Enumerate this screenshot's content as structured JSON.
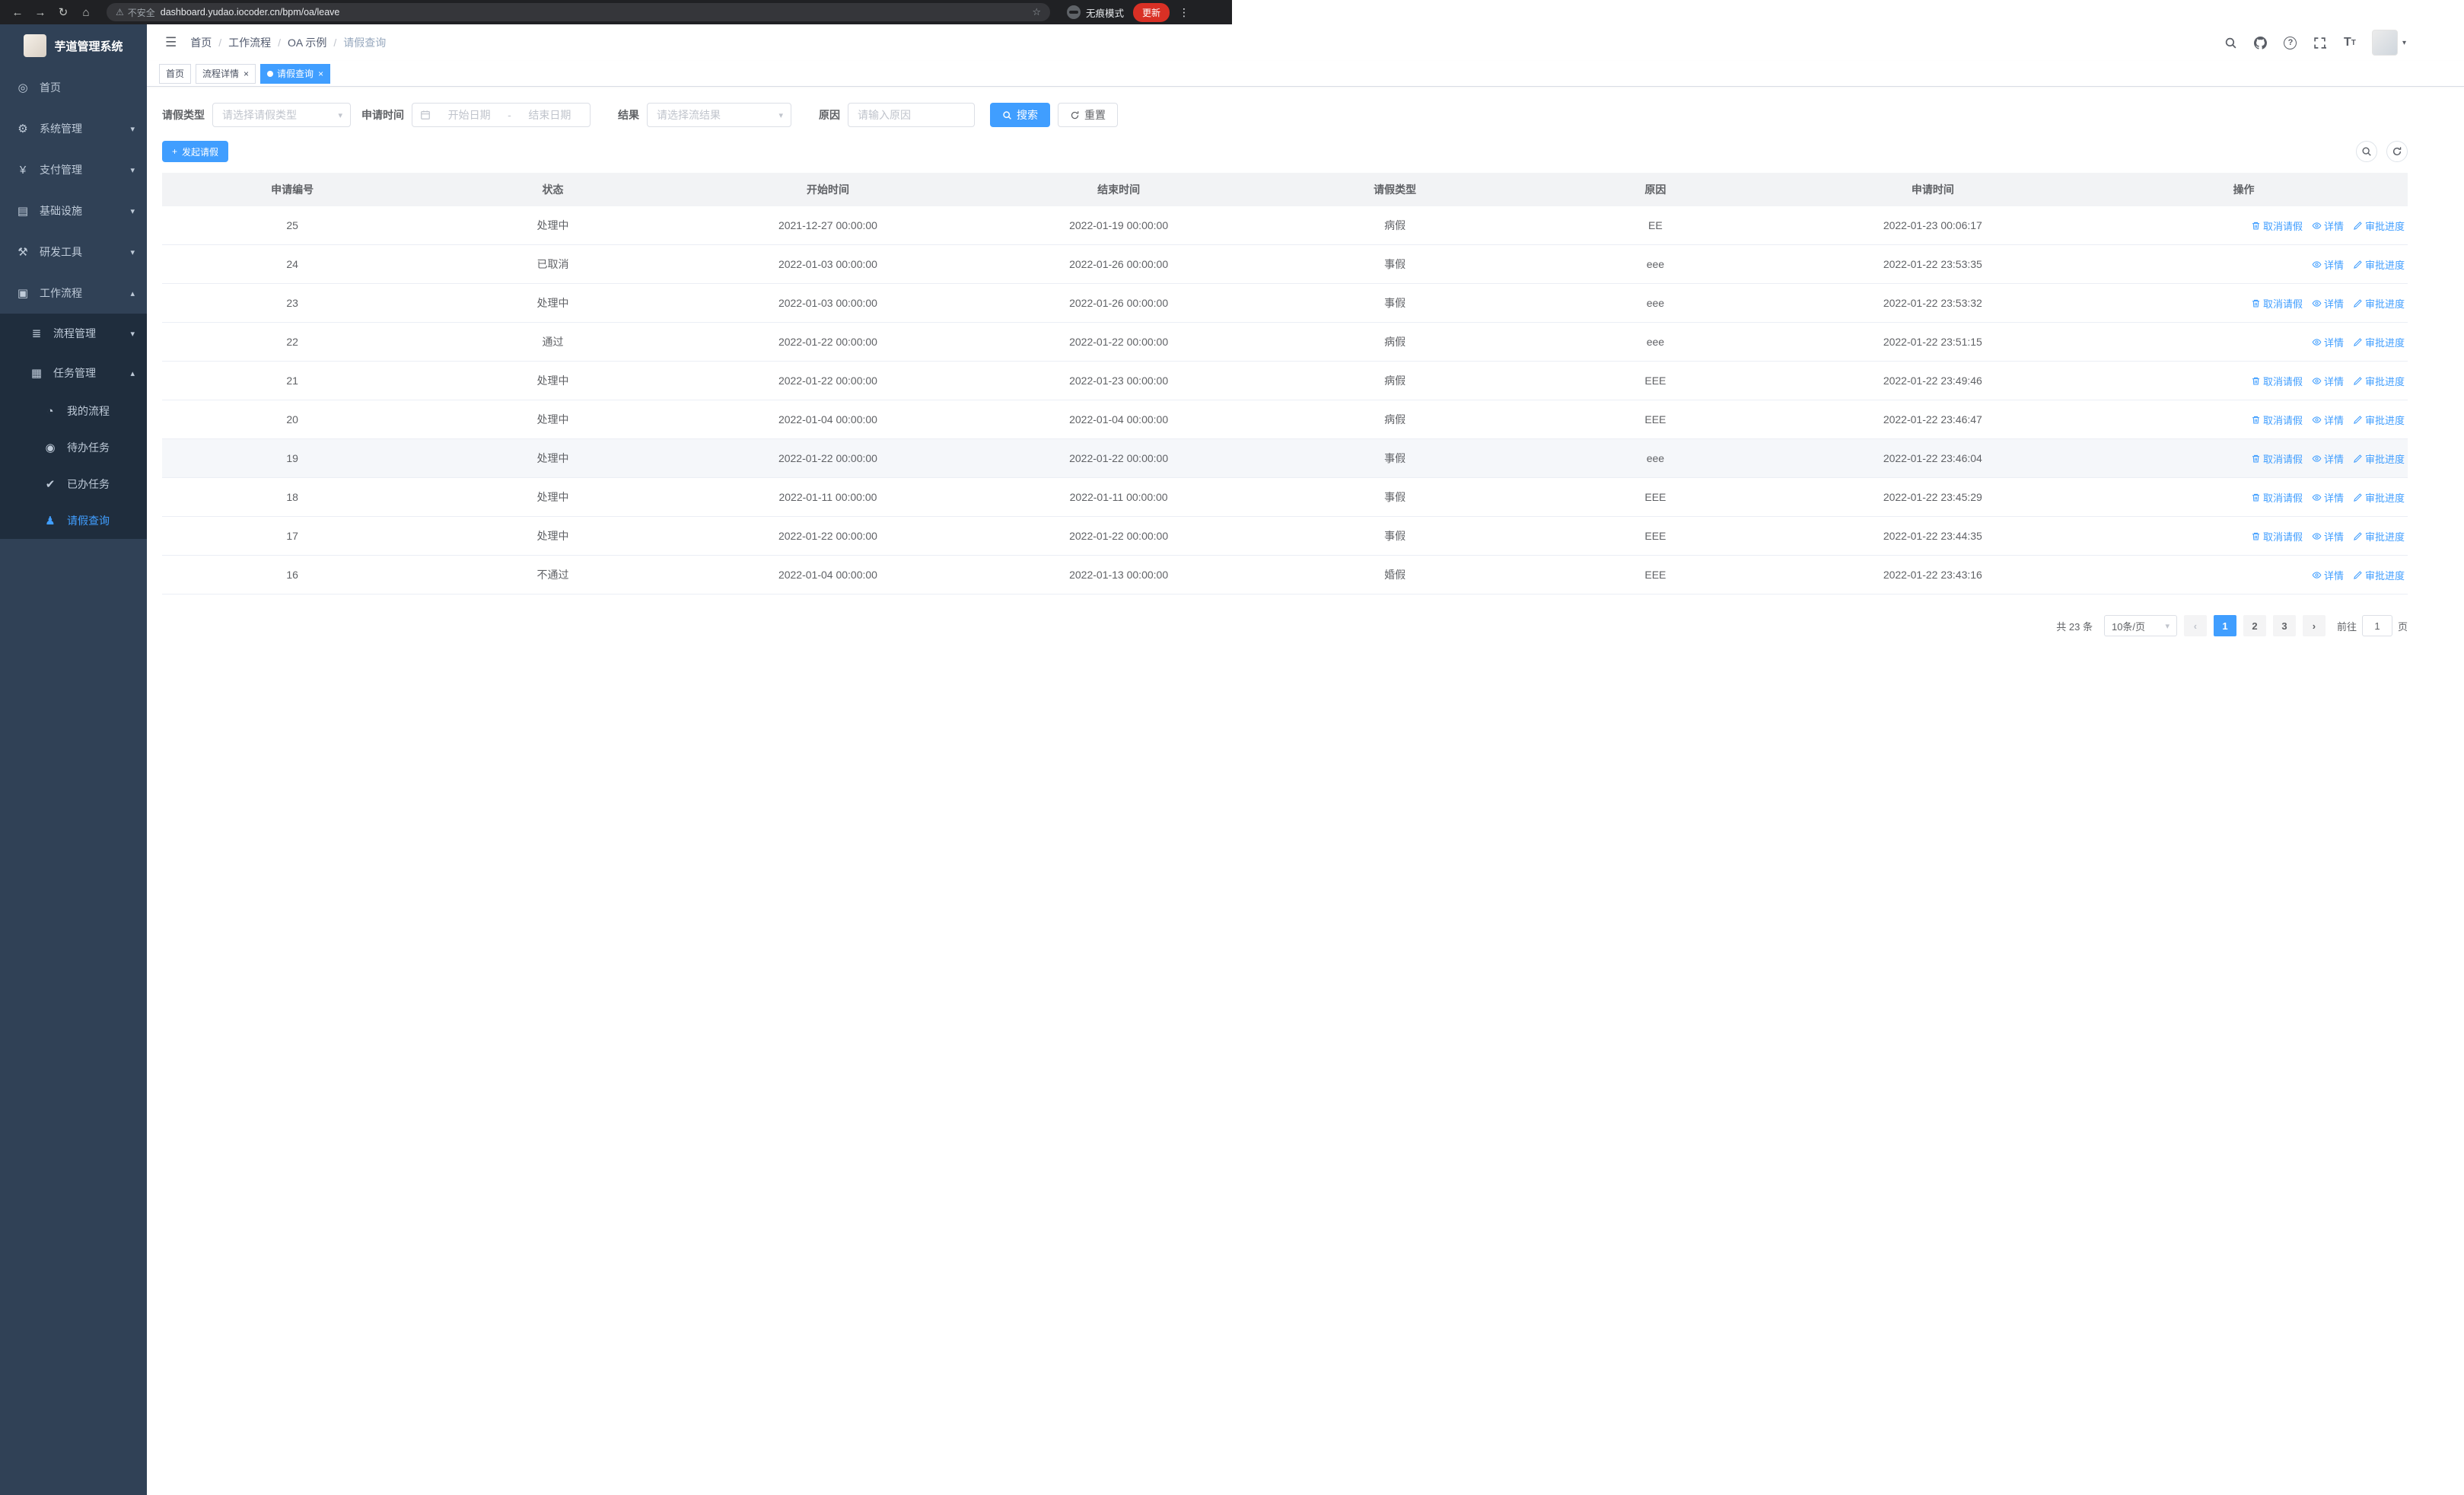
{
  "colors": {
    "primary": "#409eff",
    "sidebar_bg": "#304156",
    "submenu_bg": "#1f2d3d",
    "chrome_bg": "#202124"
  },
  "icons": {
    "back": "←",
    "forward": "→",
    "reload": "↻",
    "home": "⌂",
    "warning": "⚠",
    "star": "☆",
    "dots": "⋮",
    "hamburger": "☰",
    "close": "×",
    "caret": "▾",
    "question": "?",
    "font_size": "T",
    "plus": "+",
    "range_sep": "-",
    "dashboard": "◎",
    "gear": "⚙",
    "yen": "¥",
    "infra": "▤",
    "tools": "⚒",
    "workflow": "▣",
    "process": "≣",
    "task": "▦",
    "chat": "◔",
    "eye": "◉",
    "check": "✔",
    "user": "♟"
  },
  "browser": {
    "security_warning": "不安全",
    "url": "dashboard.yudao.iocoder.cn/bpm/oa/leave",
    "incognito_label": "无痕模式",
    "update_button": "更新"
  },
  "sidebar": {
    "title": "芋道管理系统",
    "items": [
      {
        "label": "首页",
        "chev": ""
      },
      {
        "label": "系统管理",
        "chev": "▾"
      },
      {
        "label": "支付管理",
        "chev": "▾"
      },
      {
        "label": "基础设施",
        "chev": "▾"
      },
      {
        "label": "研发工具",
        "chev": "▾"
      },
      {
        "label": "工作流程",
        "chev": "▴"
      }
    ],
    "submenu": [
      {
        "label": "流程管理",
        "chev": "▾"
      },
      {
        "label": "任务管理",
        "chev": "▴"
      }
    ],
    "task_items": [
      {
        "label": "我的流程"
      },
      {
        "label": "待办任务"
      },
      {
        "label": "已办任务"
      },
      {
        "label": "请假查询"
      }
    ]
  },
  "header": {
    "breadcrumb": [
      "首页",
      "工作流程",
      "OA 示例",
      "请假查询"
    ]
  },
  "tabs": [
    {
      "label": "首页"
    },
    {
      "label": "流程详情"
    },
    {
      "label": "请假查询"
    }
  ],
  "filters": {
    "leave_type_label": "请假类型",
    "leave_type_placeholder": "请选择请假类型",
    "apply_time_label": "申请时间",
    "start_date_placeholder": "开始日期",
    "end_date_placeholder": "结束日期",
    "result_label": "结果",
    "result_placeholder": "请选择流结果",
    "reason_label": "原因",
    "reason_placeholder": "请输入原因",
    "search_button": "搜索",
    "reset_button": "重置"
  },
  "toolbar": {
    "create_button": "发起请假"
  },
  "table": {
    "headers": [
      "申请编号",
      "状态",
      "开始时间",
      "结束时间",
      "请假类型",
      "原因",
      "申请时间",
      "操作"
    ],
    "action_labels": {
      "cancel": "取消请假",
      "detail": "详情",
      "progress": "审批进度"
    },
    "rows": [
      {
        "id": "25",
        "status": "处理中",
        "start": "2021-12-27 00:00:00",
        "end": "2022-01-19 00:00:00",
        "type": "病假",
        "reason": "EE",
        "apply_time": "2022-01-23 00:06:17",
        "actions": [
          "cancel",
          "detail",
          "progress"
        ]
      },
      {
        "id": "24",
        "status": "已取消",
        "start": "2022-01-03 00:00:00",
        "end": "2022-01-26 00:00:00",
        "type": "事假",
        "reason": "eee",
        "apply_time": "2022-01-22 23:53:35",
        "actions": [
          "detail",
          "progress"
        ]
      },
      {
        "id": "23",
        "status": "处理中",
        "start": "2022-01-03 00:00:00",
        "end": "2022-01-26 00:00:00",
        "type": "事假",
        "reason": "eee",
        "apply_time": "2022-01-22 23:53:32",
        "actions": [
          "cancel",
          "detail",
          "progress"
        ]
      },
      {
        "id": "22",
        "status": "通过",
        "start": "2022-01-22 00:00:00",
        "end": "2022-01-22 00:00:00",
        "type": "病假",
        "reason": "eee",
        "apply_time": "2022-01-22 23:51:15",
        "actions": [
          "detail",
          "progress"
        ]
      },
      {
        "id": "21",
        "status": "处理中",
        "start": "2022-01-22 00:00:00",
        "end": "2022-01-23 00:00:00",
        "type": "病假",
        "reason": "EEE",
        "apply_time": "2022-01-22 23:49:46",
        "actions": [
          "cancel",
          "detail",
          "progress"
        ]
      },
      {
        "id": "20",
        "status": "处理中",
        "start": "2022-01-04 00:00:00",
        "end": "2022-01-04 00:00:00",
        "type": "病假",
        "reason": "EEE",
        "apply_time": "2022-01-22 23:46:47",
        "actions": [
          "cancel",
          "detail",
          "progress"
        ]
      },
      {
        "id": "19",
        "status": "处理中",
        "start": "2022-01-22 00:00:00",
        "end": "2022-01-22 00:00:00",
        "type": "事假",
        "reason": "eee",
        "apply_time": "2022-01-22 23:46:04",
        "actions": [
          "cancel",
          "detail",
          "progress"
        ],
        "highlighted": true
      },
      {
        "id": "18",
        "status": "处理中",
        "start": "2022-01-11 00:00:00",
        "end": "2022-01-11 00:00:00",
        "type": "事假",
        "reason": "EEE",
        "apply_time": "2022-01-22 23:45:29",
        "actions": [
          "cancel",
          "detail",
          "progress"
        ]
      },
      {
        "id": "17",
        "status": "处理中",
        "start": "2022-01-22 00:00:00",
        "end": "2022-01-22 00:00:00",
        "type": "事假",
        "reason": "EEE",
        "apply_time": "2022-01-22 23:44:35",
        "actions": [
          "cancel",
          "detail",
          "progress"
        ]
      },
      {
        "id": "16",
        "status": "不通过",
        "start": "2022-01-04 00:00:00",
        "end": "2022-01-13 00:00:00",
        "type": "婚假",
        "reason": "EEE",
        "apply_time": "2022-01-22 23:43:16",
        "actions": [
          "detail",
          "progress"
        ]
      }
    ]
  },
  "pagination": {
    "total_text": "共 23 条",
    "page_size": "10条/页",
    "prev": "‹",
    "next": "›",
    "pages": [
      "1",
      "2",
      "3"
    ],
    "active_page": "1",
    "goto_label": "前往",
    "goto_value": "1",
    "goto_suffix": "页"
  }
}
